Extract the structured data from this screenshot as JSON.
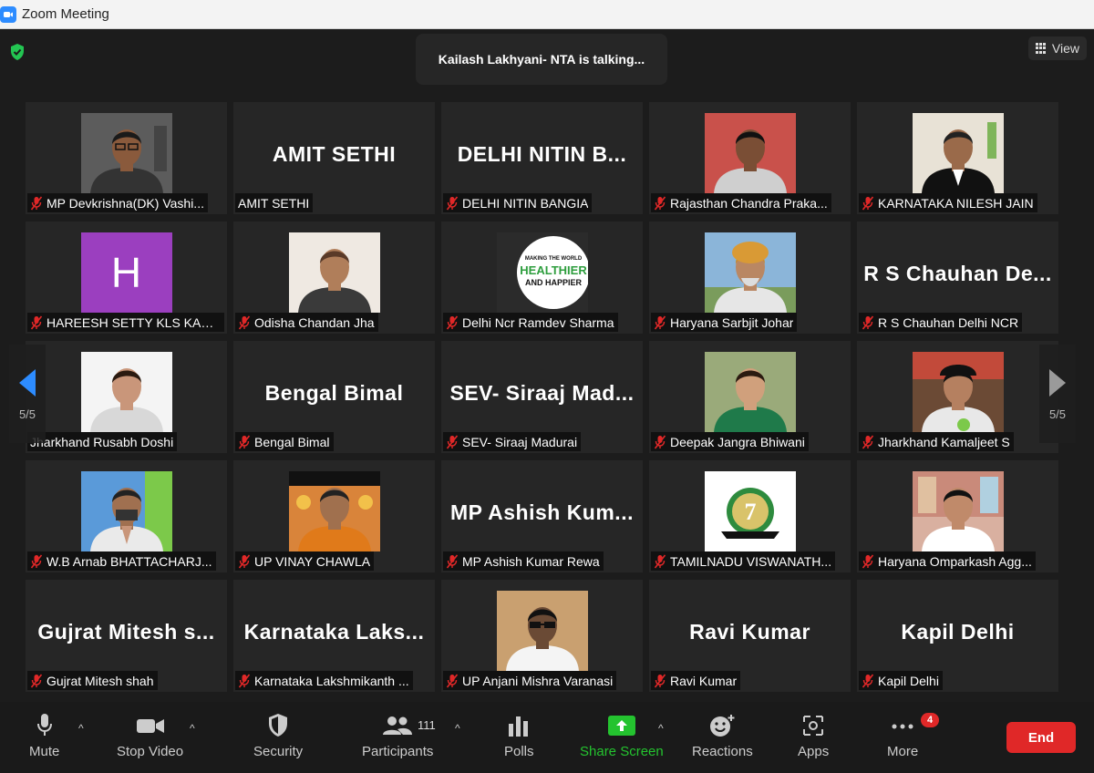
{
  "window": {
    "title": "Zoom Meeting"
  },
  "talking_indicator": "Kailash Lakhyani- NTA is talking...",
  "view_button": "View",
  "page_indicator_left": "5/5",
  "page_indicator_right": "5/5",
  "tiles": [
    {
      "label": "MP Devkrishna(DK) Vashi...",
      "muted": true,
      "type": "photo",
      "photo": "man-glasses"
    },
    {
      "label": "AMIT SETHI",
      "muted": false,
      "type": "name",
      "big": "AMIT SETHI"
    },
    {
      "label": "DELHI NITIN BANGIA",
      "muted": true,
      "type": "name",
      "big": "DELHI NITIN B..."
    },
    {
      "label": "Rajasthan Chandra Praka...",
      "muted": true,
      "type": "photo",
      "photo": "man-red-bg"
    },
    {
      "label": "KARNATAKA NILESH JAIN",
      "muted": true,
      "type": "photo",
      "photo": "man-suit"
    },
    {
      "label": "HAREESH SETTY KLS KAR...",
      "muted": true,
      "type": "avatar",
      "letter": "H",
      "color": "#9b3fbf"
    },
    {
      "label": "Odisha Chandan Jha",
      "muted": true,
      "type": "photo",
      "photo": "man-bald"
    },
    {
      "label": "Delhi Ncr Ramdev Sharma",
      "muted": true,
      "type": "photo",
      "photo": "healthier-logo"
    },
    {
      "label": "Haryana Sarbjit Johar",
      "muted": true,
      "type": "photo",
      "photo": "man-turban"
    },
    {
      "label": "R S Chauhan Delhi NCR",
      "muted": true,
      "type": "name",
      "big": "R S Chauhan De..."
    },
    {
      "label": "Jharkhand Rusabh Doshi",
      "muted": false,
      "type": "photo",
      "photo": "man-young"
    },
    {
      "label": "Bengal Bimal",
      "muted": true,
      "type": "name",
      "big": "Bengal Bimal"
    },
    {
      "label": "SEV- Siraaj Madurai",
      "muted": true,
      "type": "name",
      "big": "SEV- Siraaj Mad..."
    },
    {
      "label": "Deepak Jangra Bhiwani",
      "muted": true,
      "type": "photo",
      "photo": "man-green"
    },
    {
      "label": "Jharkhand Kamaljeet S",
      "muted": true,
      "type": "photo",
      "photo": "man-cap"
    },
    {
      "label": "W.B Arnab BHATTACHARJ...",
      "muted": true,
      "type": "photo",
      "photo": "man-namaste"
    },
    {
      "label": "UP VINAY CHAWLA",
      "muted": true,
      "type": "photo",
      "photo": "man-orange"
    },
    {
      "label": "MP Ashish Kumar Rewa",
      "muted": true,
      "type": "name",
      "big": "MP Ashish Kum..."
    },
    {
      "label": "TAMILNADU VISWANATH...",
      "muted": true,
      "type": "photo",
      "photo": "anniversary-logo"
    },
    {
      "label": "Haryana Omparkash Agg...",
      "muted": true,
      "type": "photo",
      "photo": "man-shop"
    },
    {
      "label": "Gujrat  Mitesh shah",
      "muted": true,
      "type": "name",
      "big": "Gujrat  Mitesh s..."
    },
    {
      "label": "Karnataka Lakshmikanth ...",
      "muted": true,
      "type": "name",
      "big": "Karnataka  Laks..."
    },
    {
      "label": "UP Anjani Mishra Varanasi",
      "muted": true,
      "type": "photo",
      "photo": "man-sunglasses"
    },
    {
      "label": "Ravi Kumar",
      "muted": true,
      "type": "name",
      "big": "Ravi Kumar"
    },
    {
      "label": "Kapil Delhi",
      "muted": true,
      "type": "name",
      "big": "Kapil Delhi"
    }
  ],
  "logo_text": {
    "healthier": [
      "MAKING THE WORLD",
      "HEALTHIER",
      "AND HAPPIER"
    ],
    "anniversary": "7"
  },
  "toolbar": {
    "mute": "Mute",
    "stop_video": "Stop Video",
    "security": "Security",
    "participants": "Participants",
    "participants_count": "111",
    "polls": "Polls",
    "share_screen": "Share Screen",
    "reactions": "Reactions",
    "apps": "Apps",
    "more": "More",
    "more_badge": "4",
    "end": "End"
  },
  "colors": {
    "share_green": "#24c32f",
    "end_red": "#e02828",
    "zoom_blue": "#2d8cff",
    "nav_arrow": "#2d8cff"
  }
}
